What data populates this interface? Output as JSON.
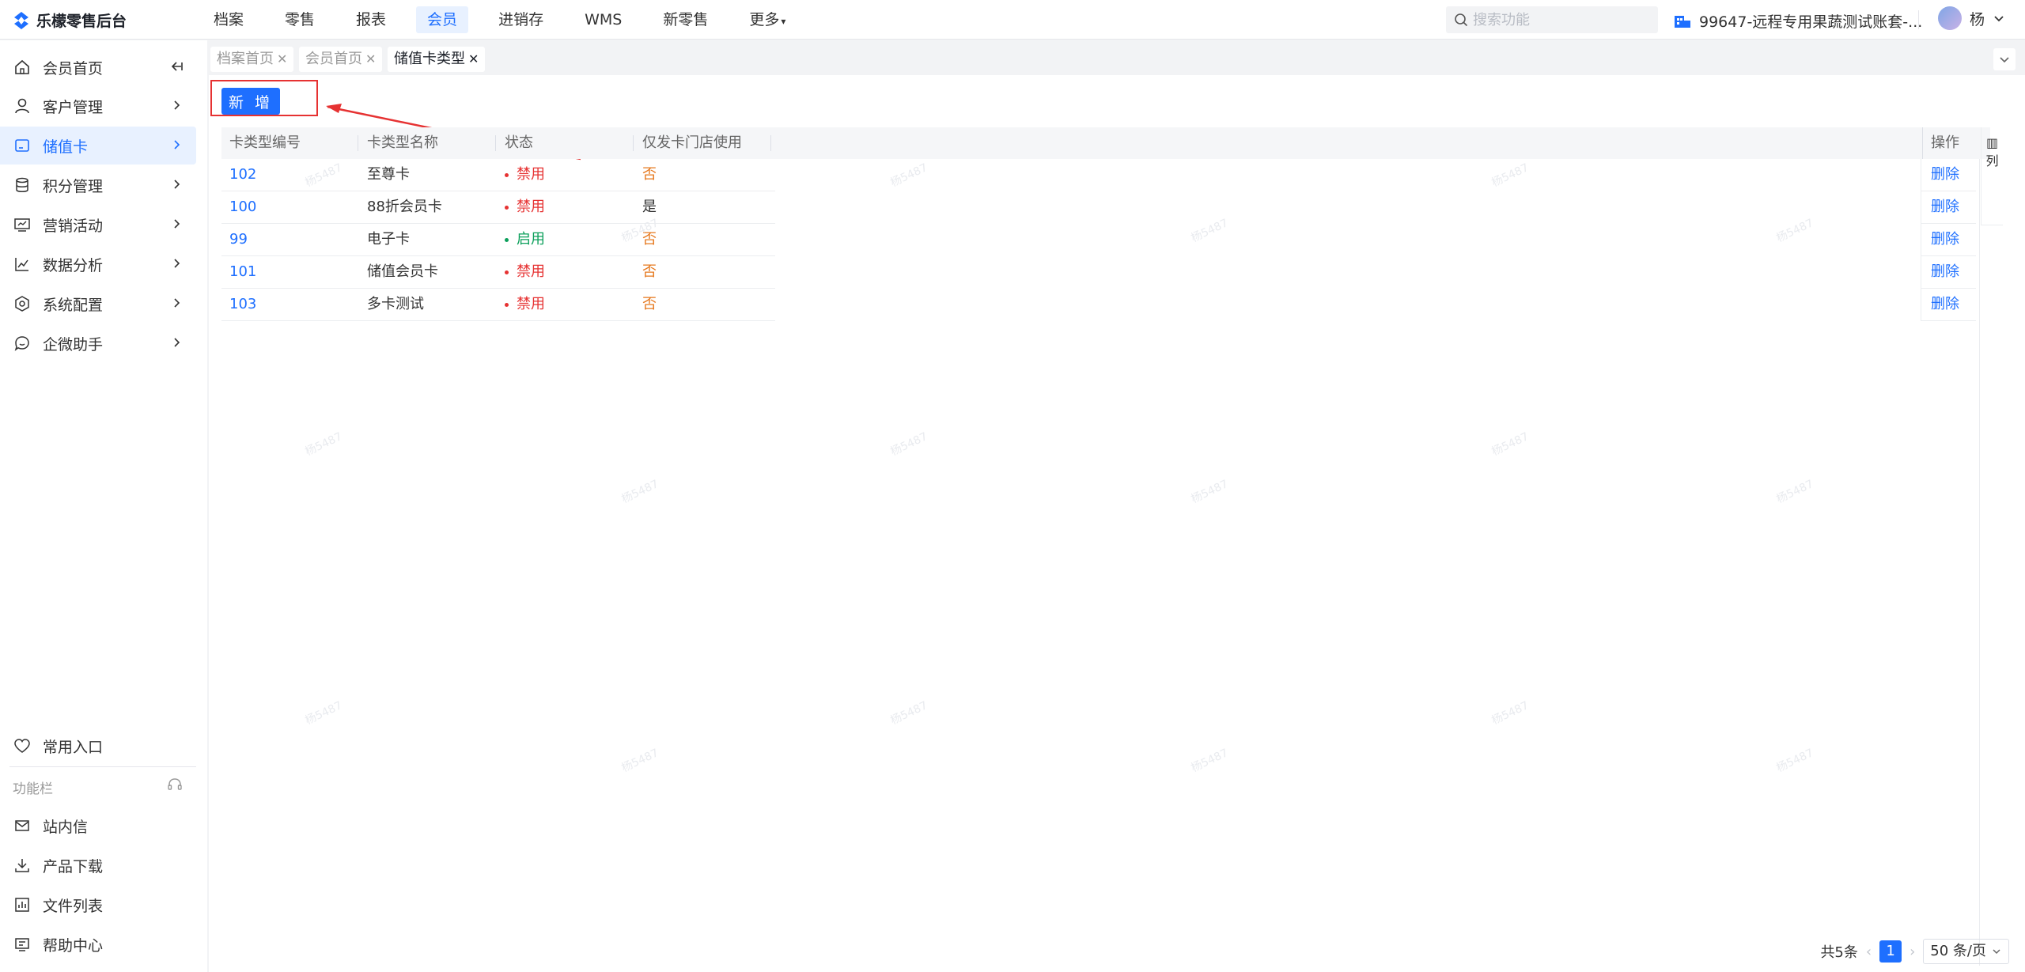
{
  "app": {
    "logo_text": "乐檬零售后台",
    "top_nav": [
      {
        "label": "档案",
        "active": false
      },
      {
        "label": "零售",
        "active": false
      },
      {
        "label": "报表",
        "active": false
      },
      {
        "label": "会员",
        "active": true
      },
      {
        "label": "进销存",
        "active": false
      },
      {
        "label": "WMS",
        "active": false
      },
      {
        "label": "新零售",
        "active": false
      },
      {
        "label": "更多",
        "active": false
      }
    ],
    "search_placeholder": "搜索功能",
    "account": "99647-远程专用果蔬测试账套-...",
    "user_name": "杨"
  },
  "sidebar": {
    "items": [
      {
        "label": "会员首页",
        "icon": "home-icon"
      },
      {
        "label": "客户管理",
        "icon": "user-icon"
      },
      {
        "label": "储值卡",
        "icon": "card-icon",
        "active": true
      },
      {
        "label": "积分管理",
        "icon": "database-icon"
      },
      {
        "label": "营销活动",
        "icon": "monitor-icon"
      },
      {
        "label": "数据分析",
        "icon": "chart-icon"
      },
      {
        "label": "系统配置",
        "icon": "settings-icon"
      },
      {
        "label": "企微助手",
        "icon": "chat-icon"
      }
    ],
    "favorites": "常用入口",
    "function_bar": "功能栏",
    "tools": [
      {
        "label": "站内信",
        "icon": "mail-icon"
      },
      {
        "label": "产品下载",
        "icon": "download-icon"
      },
      {
        "label": "文件列表",
        "icon": "file-chart-icon"
      },
      {
        "label": "帮助中心",
        "icon": "help-icon"
      }
    ]
  },
  "tabs": [
    {
      "label": "档案首页",
      "active": false
    },
    {
      "label": "会员首页",
      "active": false
    },
    {
      "label": "储值卡类型",
      "active": true
    }
  ],
  "toolbar": {
    "add_label": "新 增"
  },
  "table": {
    "columns": [
      "卡类型编号",
      "卡类型名称",
      "状态",
      "仅发卡门店使用"
    ],
    "op_header": "操作",
    "col_setting": "列",
    "rows": [
      {
        "code": "102",
        "name": "至尊卡",
        "status": "禁用",
        "store_only": "否",
        "op": "删除"
      },
      {
        "code": "100",
        "name": "88折会员卡",
        "status": "禁用",
        "store_only": "是",
        "op": "删除"
      },
      {
        "code": "99",
        "name": "电子卡",
        "status": "启用",
        "store_only": "否",
        "op": "删除"
      },
      {
        "code": "101",
        "name": "储值会员卡",
        "status": "禁用",
        "store_only": "否",
        "op": "删除"
      },
      {
        "code": "103",
        "name": "多卡测试",
        "status": "禁用",
        "store_only": "否",
        "op": "删除"
      }
    ]
  },
  "pagination": {
    "total": "共5条",
    "current_page": "1",
    "page_size": "50 条/页"
  },
  "watermark": "杨5487",
  "colors": {
    "primary": "#1e6fff",
    "danger": "#e63232",
    "success": "#0b9f5a",
    "warning": "#e6781e"
  }
}
